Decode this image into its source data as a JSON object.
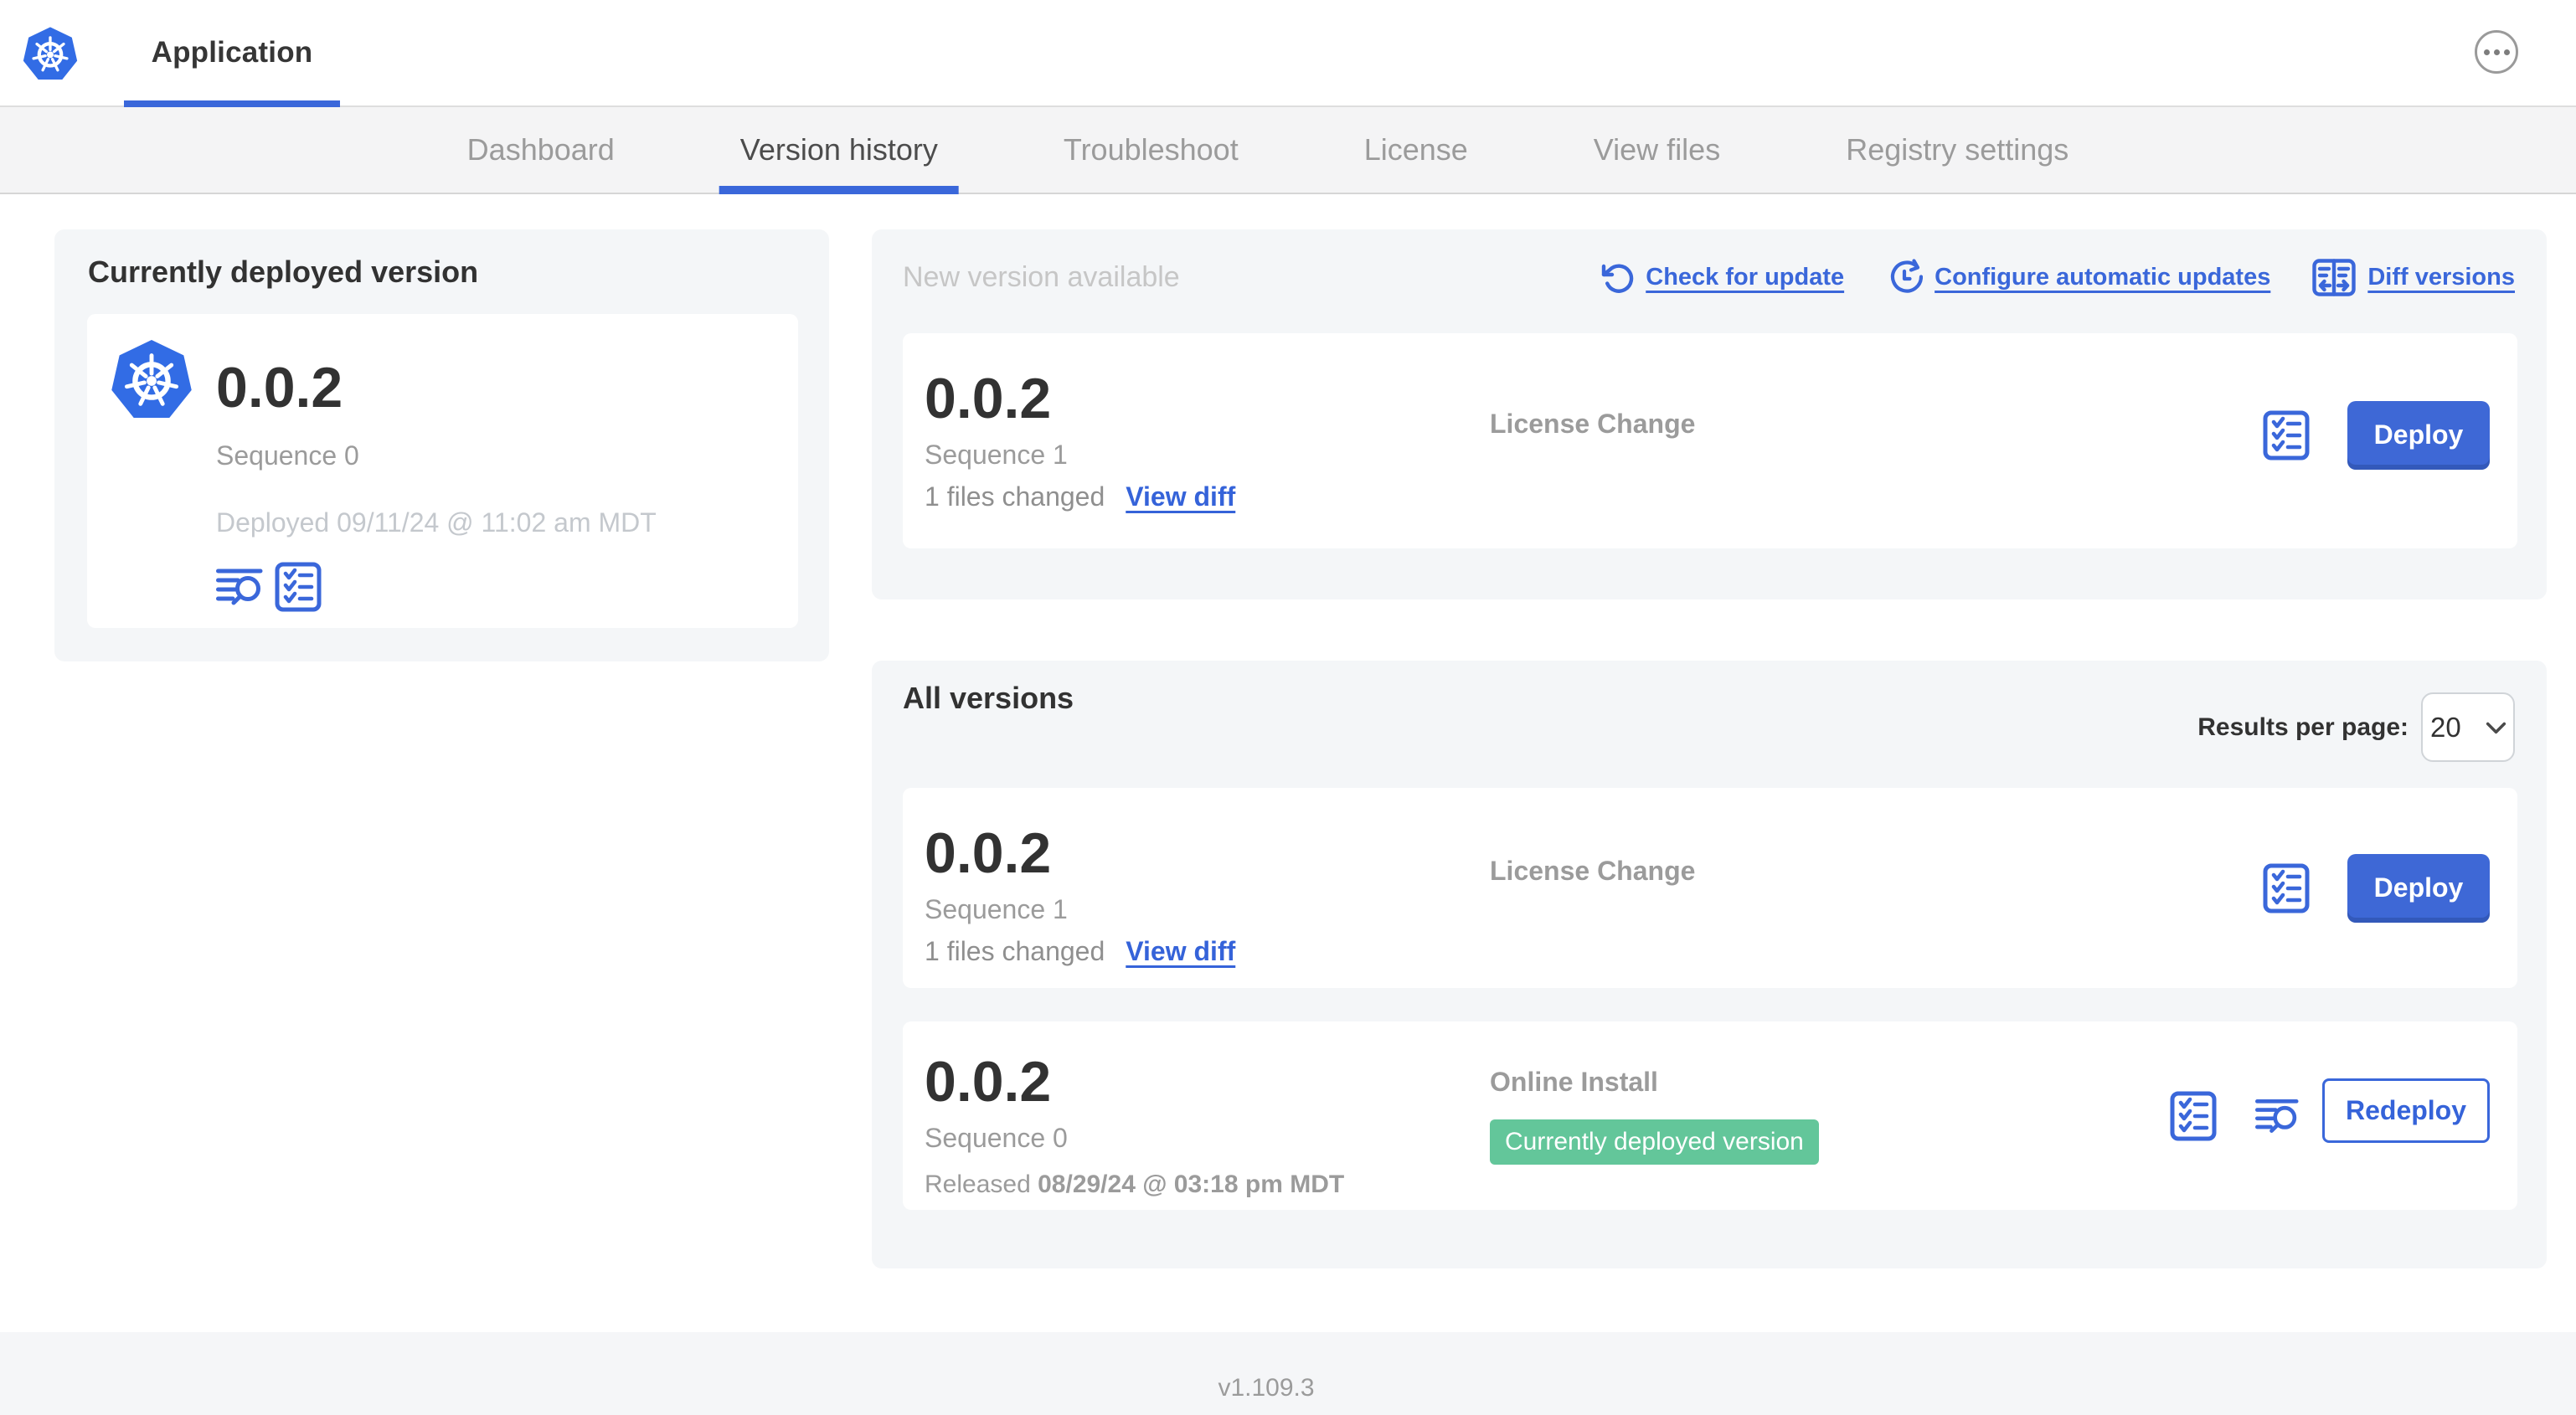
{
  "colors": {
    "accent_blue": "#3a67da",
    "kubernetes_blue": "#326ce5",
    "success_green": "#63c69a",
    "panel_gray": "#f4f6f8",
    "text_dark": "#323232",
    "text_muted": "#9b9b9b",
    "text_faded": "#c6c6c6"
  },
  "header": {
    "app_tab_label": "Application"
  },
  "subnav": {
    "tabs": [
      "Dashboard",
      "Version history",
      "Troubleshoot",
      "License",
      "View files",
      "Registry settings"
    ],
    "active_tab": "Version history"
  },
  "deployed_panel": {
    "title": "Currently deployed version",
    "version": "0.0.2",
    "sequence": "Sequence 0",
    "deployed_at": "Deployed 09/11/24 @ 11:02 am MDT"
  },
  "new_version_panel": {
    "title": "New version available",
    "actions": {
      "check_for_update": "Check for update",
      "configure_automatic_updates": "Configure automatic updates",
      "diff_versions": "Diff versions"
    },
    "card": {
      "version": "0.0.2",
      "sequence": "Sequence 1",
      "files_changed": "1 files changed",
      "view_diff": "View diff",
      "status_label": "License Change",
      "deploy_label": "Deploy"
    }
  },
  "all_versions_panel": {
    "title": "All versions",
    "results_per_page_label": "Results per page:",
    "results_per_page_value": "20",
    "cards": [
      {
        "version": "0.0.2",
        "sequence": "Sequence 1",
        "files_changed": "1 files changed",
        "view_diff": "View diff",
        "status_label": "License Change",
        "deploy_label": "Deploy"
      },
      {
        "version": "0.0.2",
        "sequence": "Sequence 0",
        "released_prefix": "Released",
        "released_at": "08/29/24 @ 03:18 pm MDT",
        "status_label": "Online Install",
        "badge_label": "Currently deployed version",
        "redeploy_label": "Redeploy"
      }
    ]
  },
  "footer": {
    "app_version": "v1.109.3"
  }
}
